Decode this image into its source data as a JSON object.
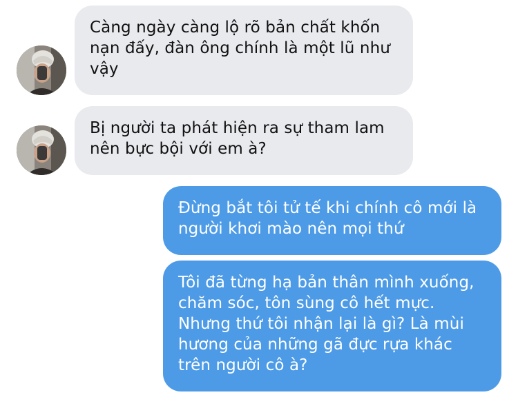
{
  "messages": [
    {
      "direction": "incoming",
      "text": "Càng ngày càng lộ rõ bản chất khốn nạn đấy, đàn ông chính là một lũ như vậy"
    },
    {
      "direction": "incoming",
      "text": "Bị người ta phát hiện ra sự tham lam nên bực bội với em à?"
    },
    {
      "direction": "outgoing",
      "text": "Đừng bắt tôi tử tế khi chính cô mới là người khơi mào nên mọi thứ"
    },
    {
      "direction": "outgoing",
      "text": "Tôi đã từng hạ bản thân mình xuống, chăm sóc, tôn sùng cô hết mực. Nhưng thứ tôi nhận lại là gì? Là mùi hương của những gã đực rựa khác trên người cô à?"
    }
  ],
  "colors": {
    "incoming_bubble": "#e9eaee",
    "incoming_text": "#111111",
    "outgoing_bubble": "#4d9be7",
    "outgoing_text": "#ffffff",
    "background": "#ffffff"
  },
  "icons": {
    "avatar": "contact-avatar-photo"
  }
}
